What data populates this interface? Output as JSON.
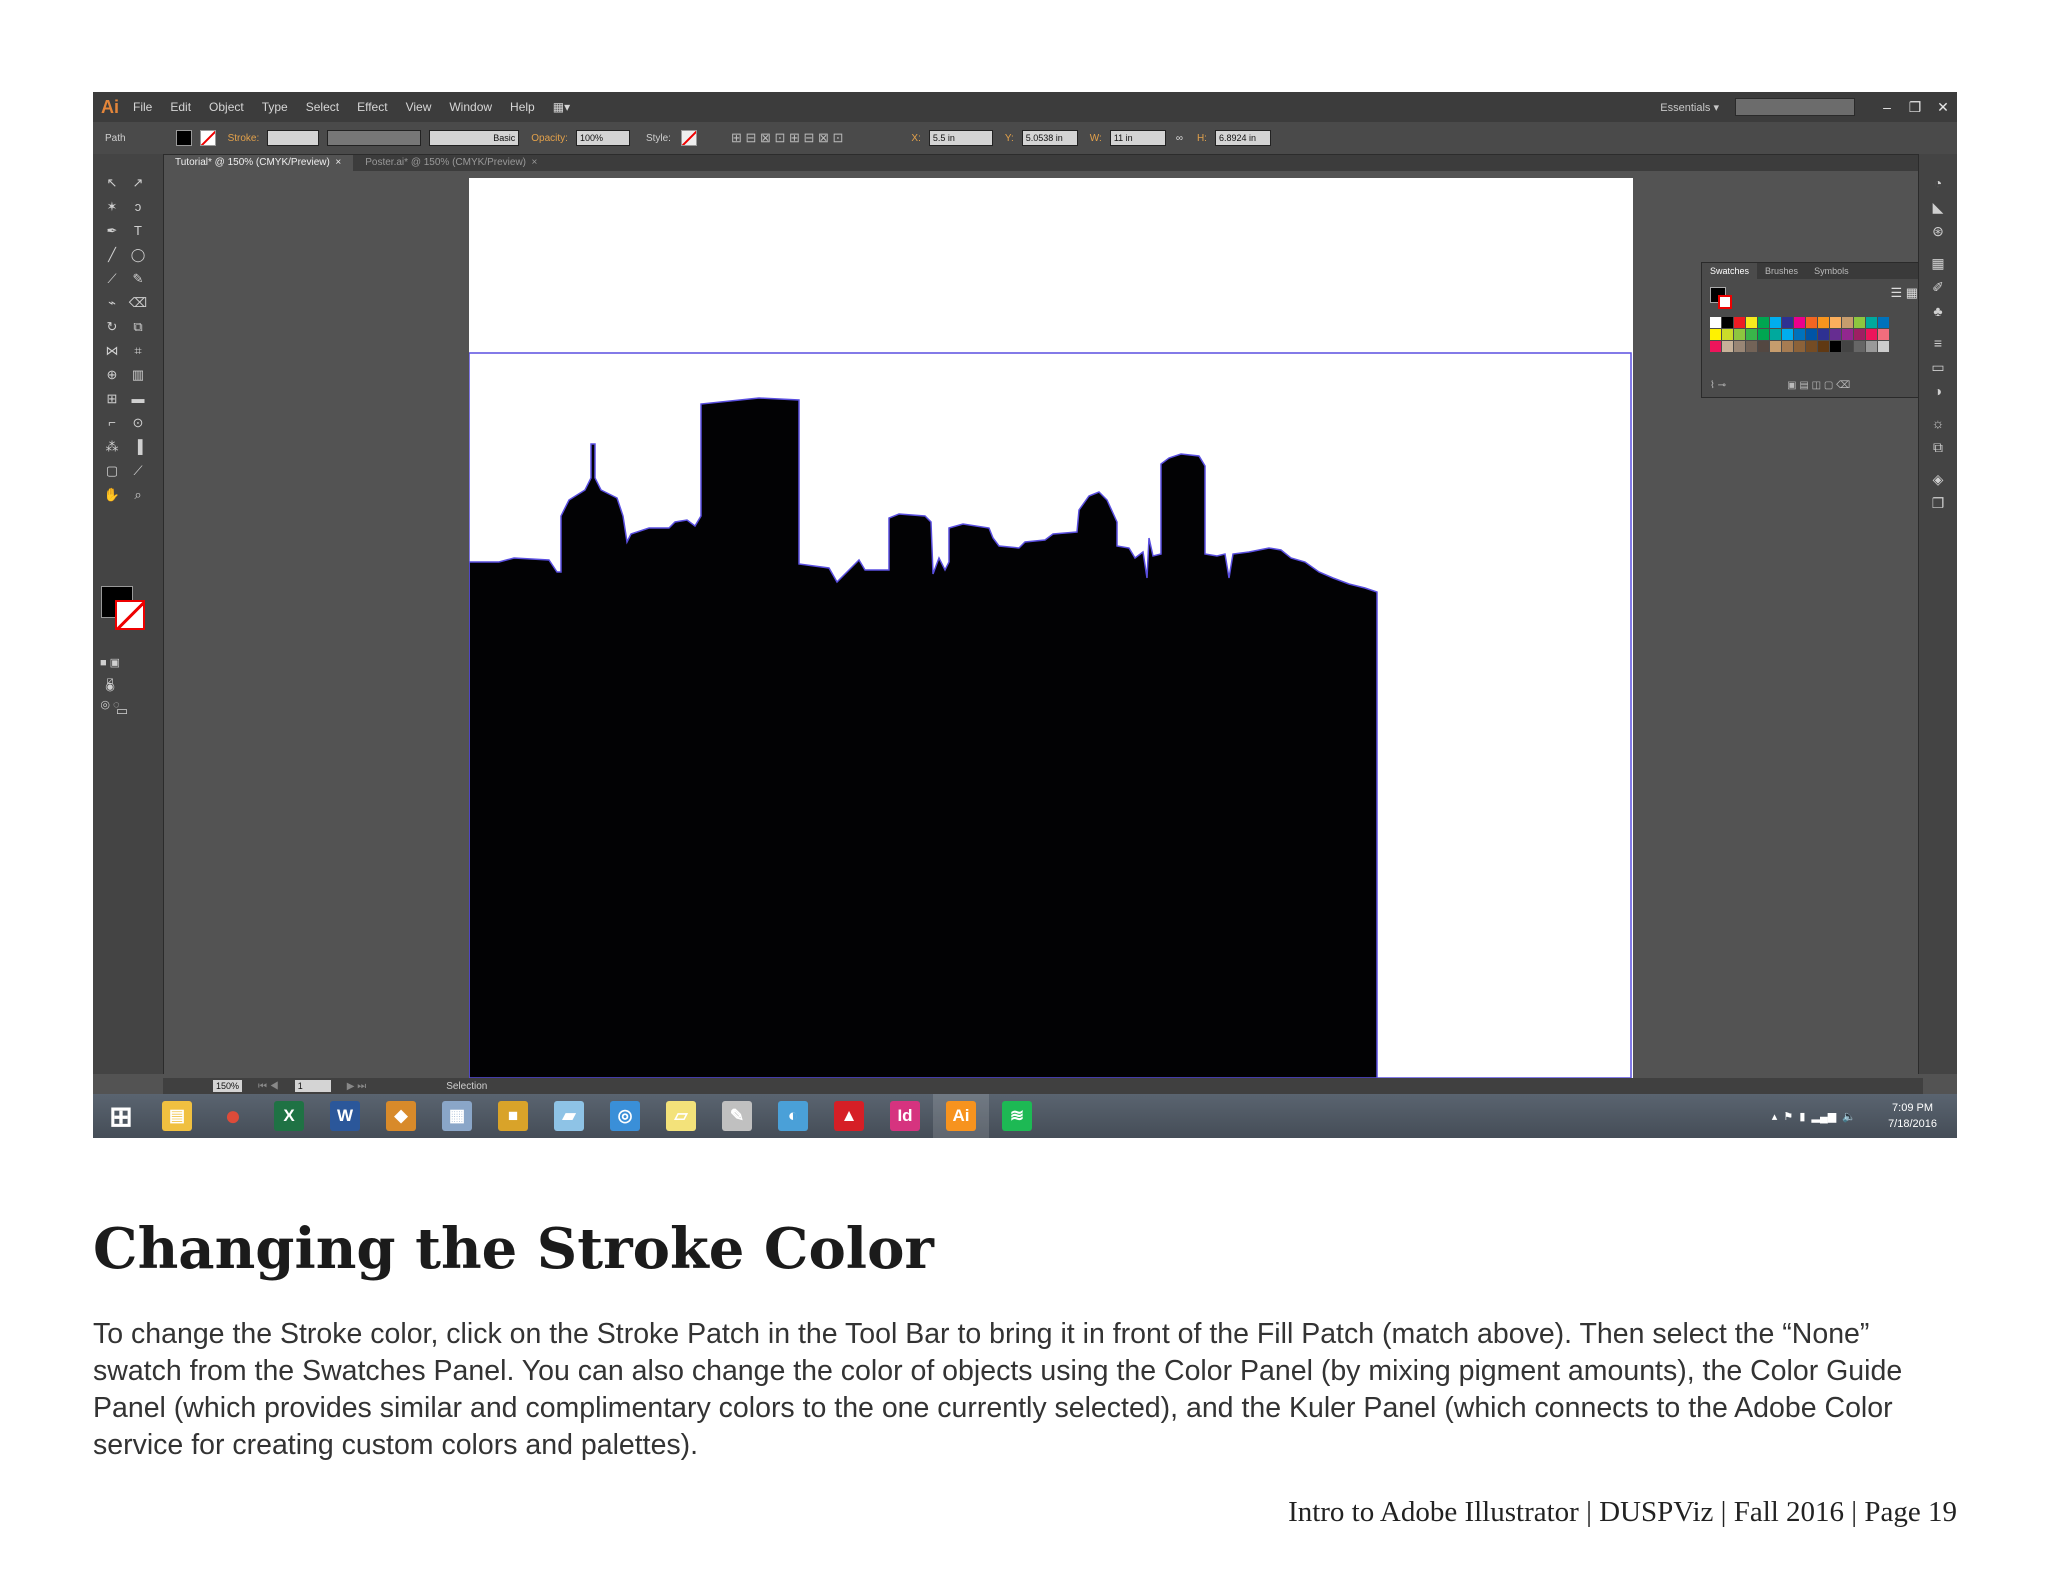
{
  "screenshot": {
    "app_logo": "Ai",
    "menu": [
      "File",
      "Edit",
      "Object",
      "Type",
      "Select",
      "Effect",
      "View",
      "Window",
      "Help"
    ],
    "workspace": "Essentials",
    "control_bar": {
      "selection_type": "Path",
      "stroke_label": "Stroke:",
      "brush": "Basic",
      "opacity_label": "Opacity:",
      "opacity_value": "100%",
      "style_label": "Style:",
      "x_label": "X:",
      "x_value": "5.5 in",
      "y_label": "Y:",
      "y_value": "5.0538 in",
      "w_label": "W:",
      "w_value": "11 in",
      "h_label": "H:",
      "h_value": "6.8924 in"
    },
    "tabs": [
      "Tutorial* @ 150% (CMYK/Preview)",
      "Poster.ai* @ 150% (CMYK/Preview)"
    ],
    "panel_tabs": [
      "Swatches",
      "Brushes",
      "Symbols"
    ],
    "swatch_colors": [
      "#ffffff",
      "#000000",
      "#ed1c24",
      "#f7ea1e",
      "#00a651",
      "#00aeef",
      "#2e3192",
      "#ec008c",
      "#f26522",
      "#f7941d",
      "#fbaf5d",
      "#c69c6d",
      "#8dc63f",
      "#00a99d",
      "#0072bc",
      "#fff200",
      "#cbdb2a",
      "#8dc63f",
      "#39b54a",
      "#00a651",
      "#00a99d",
      "#00aeef",
      "#0072bc",
      "#0054a6",
      "#2e3192",
      "#662d91",
      "#92278f",
      "#9e1f63",
      "#ed145b",
      "#f26d7d",
      "#ed145b",
      "#c7b299",
      "#998675",
      "#736357",
      "#534741",
      "#c69c6d",
      "#a67c52",
      "#8c6239",
      "#754c24",
      "#603913",
      "#000000",
      "#444444",
      "#666666",
      "#999999",
      "#cccccc"
    ],
    "status": {
      "zoom": "150%",
      "page": "1",
      "mode": "Selection"
    },
    "taskbar": {
      "apps": [
        {
          "name": "windows-start",
          "glyph": "⊞",
          "color": "#ffffff"
        },
        {
          "name": "file-explorer",
          "glyph": "▤",
          "color": "#f0c040"
        },
        {
          "name": "chrome",
          "glyph": "●",
          "color": "#dd4b39"
        },
        {
          "name": "excel",
          "glyph": "X",
          "color": "#1f7244"
        },
        {
          "name": "word",
          "glyph": "W",
          "color": "#2b579a"
        },
        {
          "name": "app-diamond",
          "glyph": "◆",
          "color": "#d88a2a"
        },
        {
          "name": "calculator",
          "glyph": "▦",
          "color": "#8aa6c8"
        },
        {
          "name": "packages",
          "glyph": "■",
          "color": "#d9a329"
        },
        {
          "name": "notepad",
          "glyph": "▰",
          "color": "#8ec3e6"
        },
        {
          "name": "magnifier",
          "glyph": "◎",
          "color": "#3a8fd8"
        },
        {
          "name": "sticky-notes",
          "glyph": "▱",
          "color": "#f3e27a"
        },
        {
          "name": "paint",
          "glyph": "✎",
          "color": "#c0c0c0"
        },
        {
          "name": "media",
          "glyph": "◐",
          "color": "#4aa0d8"
        },
        {
          "name": "acrobat",
          "glyph": "▲",
          "color": "#d61f26"
        },
        {
          "name": "indesign",
          "glyph": "Id",
          "color": "#d6337f"
        },
        {
          "name": "illustrator",
          "glyph": "Ai",
          "color": "#f7931e"
        },
        {
          "name": "spotify",
          "glyph": "≋",
          "color": "#1db954"
        }
      ],
      "time": "7:09 PM",
      "date": "7/18/2016"
    }
  },
  "heading": "Changing the Stroke Color",
  "body": "To change the Stroke color, click on the Stroke Patch in the Tool Bar to bring it in front of the Fill Patch (match above). Then select the “None” swatch from the Swatches Panel. You can also change the color of objects using the Color Panel (by mixing pigment amounts), the Color Guide Panel (which provides similar and complimentary colors to the one currently selected), and the Kuler Panel (which connects to the Adobe Color service for creating custom colors and palettes).",
  "footer": "Intro to Adobe Illustrator | DUSPViz | Fall 2016 | Page 19"
}
